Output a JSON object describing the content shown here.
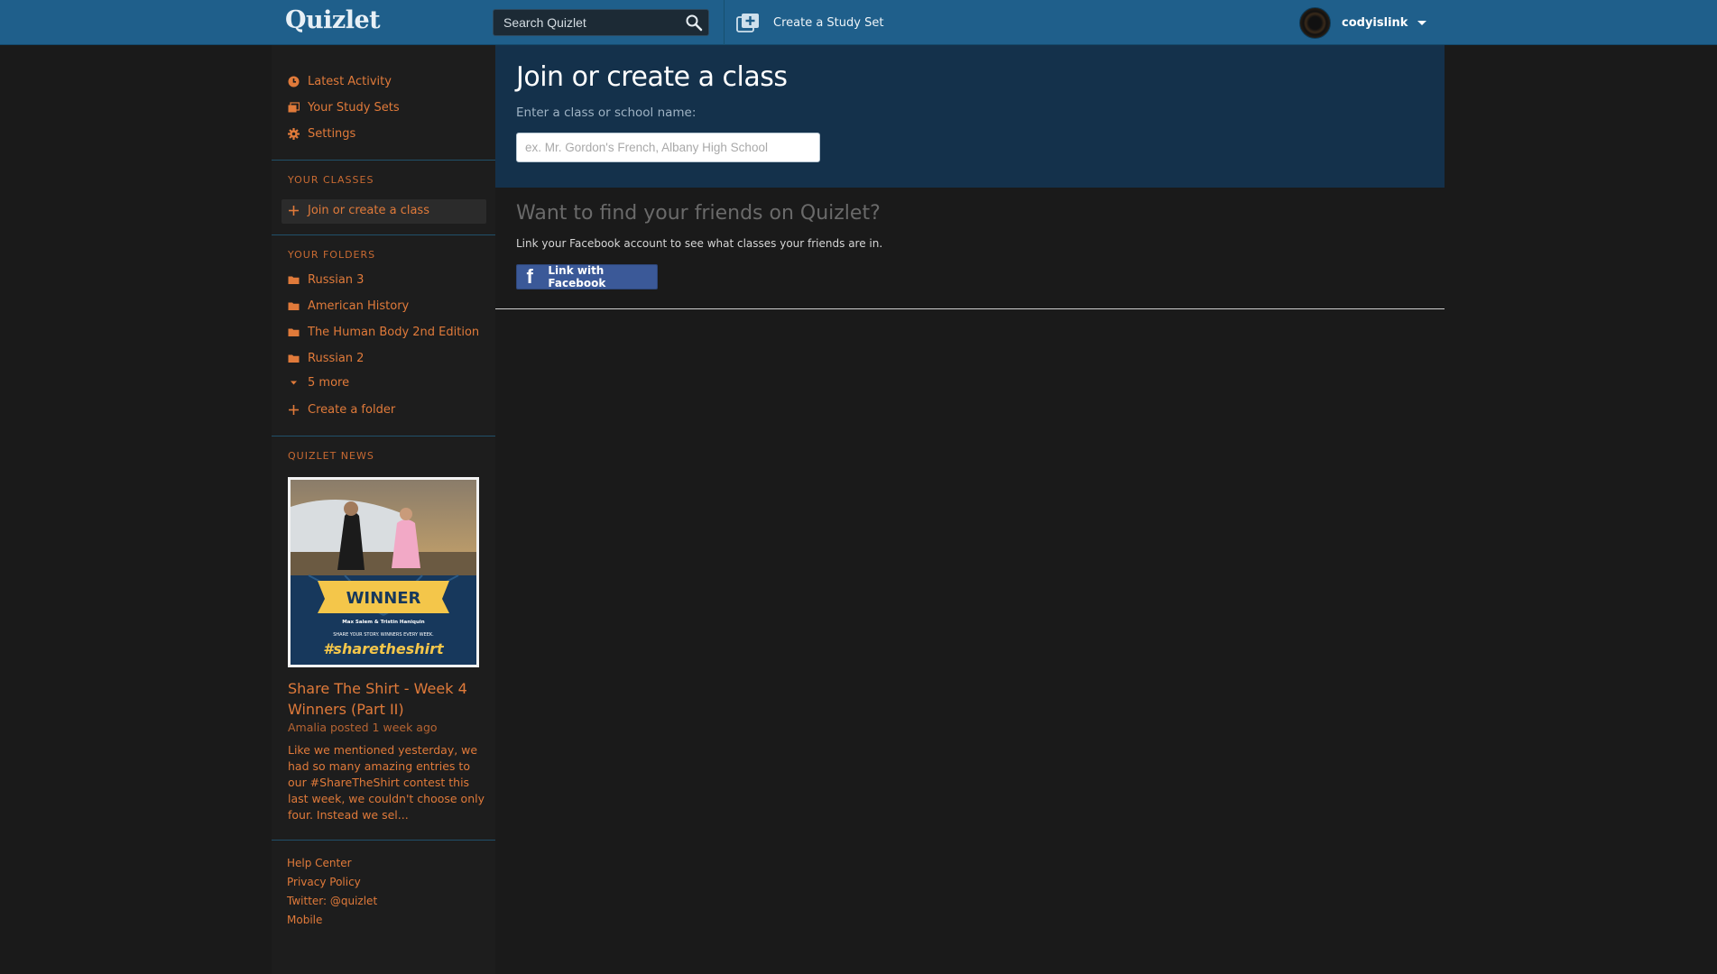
{
  "header": {
    "logo": "Quizlet",
    "search_placeholder": "Search Quizlet",
    "create_set_label": "Create a Study Set",
    "username": "codyislink"
  },
  "sidebar": {
    "nav": [
      {
        "label": "Latest Activity",
        "icon": "clock-icon"
      },
      {
        "label": "Your Study Sets",
        "icon": "sets-icon"
      },
      {
        "label": "Settings",
        "icon": "gear-icon"
      }
    ],
    "classes_title": "YOUR CLASSES",
    "join_class_label": "Join or create a class",
    "folders_title": "YOUR FOLDERS",
    "folders": [
      "Russian 3",
      "American History",
      "The Human Body 2nd Edition",
      "Russian 2"
    ],
    "more_label": "5 more",
    "create_folder_label": "Create a folder",
    "news_title": "QUIZLET NEWS",
    "news": {
      "image_banner": "WINNER",
      "image_names": "Max Salem & Tristin Haniquin",
      "image_tagline": "SHARE YOUR STORY. WINNERS EVERY WEEK.",
      "image_hashtag": "#sharetheshirt",
      "headline": "Share The Shirt - Week 4 Winners (Part II)",
      "meta": "Amalia posted 1 week ago",
      "body": "Like we mentioned yesterday, we had so many amazing entries to our #ShareTheShirt contest this last week, we couldn't choose only four. Instead we sel..."
    },
    "footer_links": [
      "Help Center",
      "Privacy Policy",
      "Twitter: @quizlet",
      "Mobile"
    ]
  },
  "main": {
    "title": "Join or create a class",
    "input_label": "Enter a class or school name:",
    "input_placeholder": "ex. Mr. Gordon's French, Albany High School",
    "friends_title": "Want to find your friends on Quizlet?",
    "friends_desc": "Link your Facebook account to see what classes your friends are in.",
    "facebook_button": "Link with Facebook"
  },
  "colors": {
    "topbar": "#1f5f8b",
    "accent": "#e07a3a",
    "hero": "#14314b",
    "facebook": "#3b5998"
  }
}
